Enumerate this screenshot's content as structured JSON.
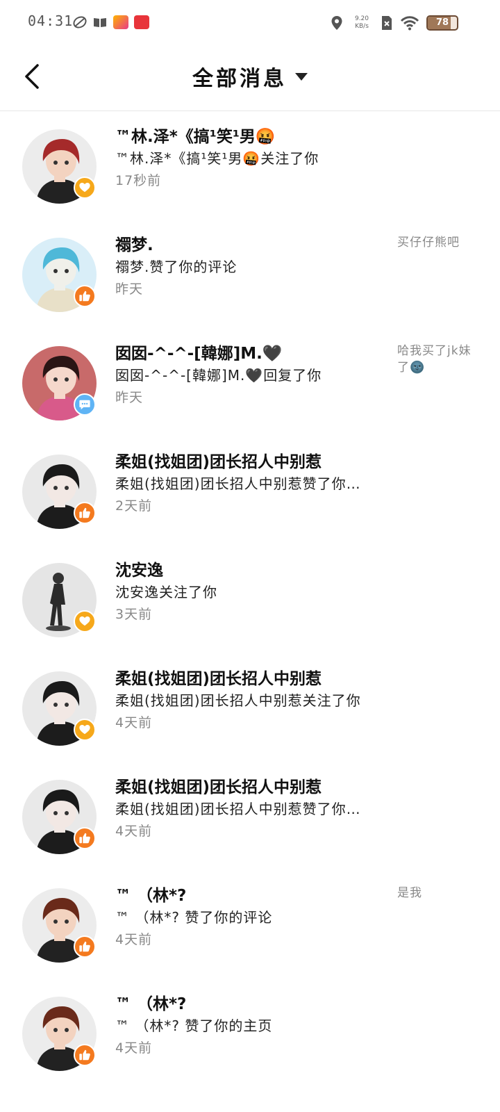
{
  "status_bar": {
    "time": "04:31",
    "speed_value": "9.20",
    "speed_unit": "KB/s",
    "battery": "78",
    "battery_level": 0.78,
    "icons": [
      "leaf-icon",
      "book-icon",
      "app-icon-1",
      "app-icon-2",
      "location-icon",
      "sim-x-icon",
      "wifi-icon",
      "battery-icon"
    ]
  },
  "header": {
    "title": "全部消息",
    "back_icon": "chevron-left-icon",
    "dropdown_icon": "caret-down-icon"
  },
  "colors": {
    "badge_like": "#f47a1f",
    "badge_follow": "#f6a81a",
    "badge_comment": "#5fb4f5",
    "time_text": "#888888"
  },
  "notifications": [
    {
      "name": "™林.泽*《搞¹笑¹男🤬",
      "action": "™林.泽*《搞¹笑¹男🤬关注了你",
      "time": "17秒前",
      "preview": "",
      "badge": "heart-icon"
    },
    {
      "name": "禤梦.",
      "action": "禤梦.赞了你的评论",
      "time": "昨天",
      "preview": "买仔仔熊吧",
      "badge": "thumbs-up-icon"
    },
    {
      "name": "囡囡-^-^-[韓娜]M.🖤",
      "action": "囡囡-^-^-[韓娜]M.🖤回复了你",
      "time": "昨天",
      "preview": "哈我买了jk妹了🌚",
      "badge": "comment-icon"
    },
    {
      "name": "柔姐(找姐团)团长招人中别惹",
      "action": "柔姐(找姐团)团长招人中别惹赞了你…",
      "time": "2天前",
      "preview": "",
      "badge": "thumbs-up-icon"
    },
    {
      "name": "沈安逸",
      "action": "沈安逸关注了你",
      "time": "3天前",
      "preview": "",
      "badge": "heart-icon"
    },
    {
      "name": "柔姐(找姐团)团长招人中别惹",
      "action": "柔姐(找姐团)团长招人中别惹关注了你",
      "time": "4天前",
      "preview": "",
      "badge": "heart-icon"
    },
    {
      "name": "柔姐(找姐团)团长招人中别惹",
      "action": "柔姐(找姐团)团长招人中别惹赞了你…",
      "time": "4天前",
      "preview": "",
      "badge": "thumbs-up-icon"
    },
    {
      "name": "™ （林*?",
      "action": "™ （林*? 赞了你的评论",
      "time": "4天前",
      "preview": "是我",
      "badge": "thumbs-up-icon"
    },
    {
      "name": "™ （林*?",
      "action": "™ （林*? 赞了你的主页",
      "time": "4天前",
      "preview": "",
      "badge": "thumbs-up-icon"
    }
  ]
}
